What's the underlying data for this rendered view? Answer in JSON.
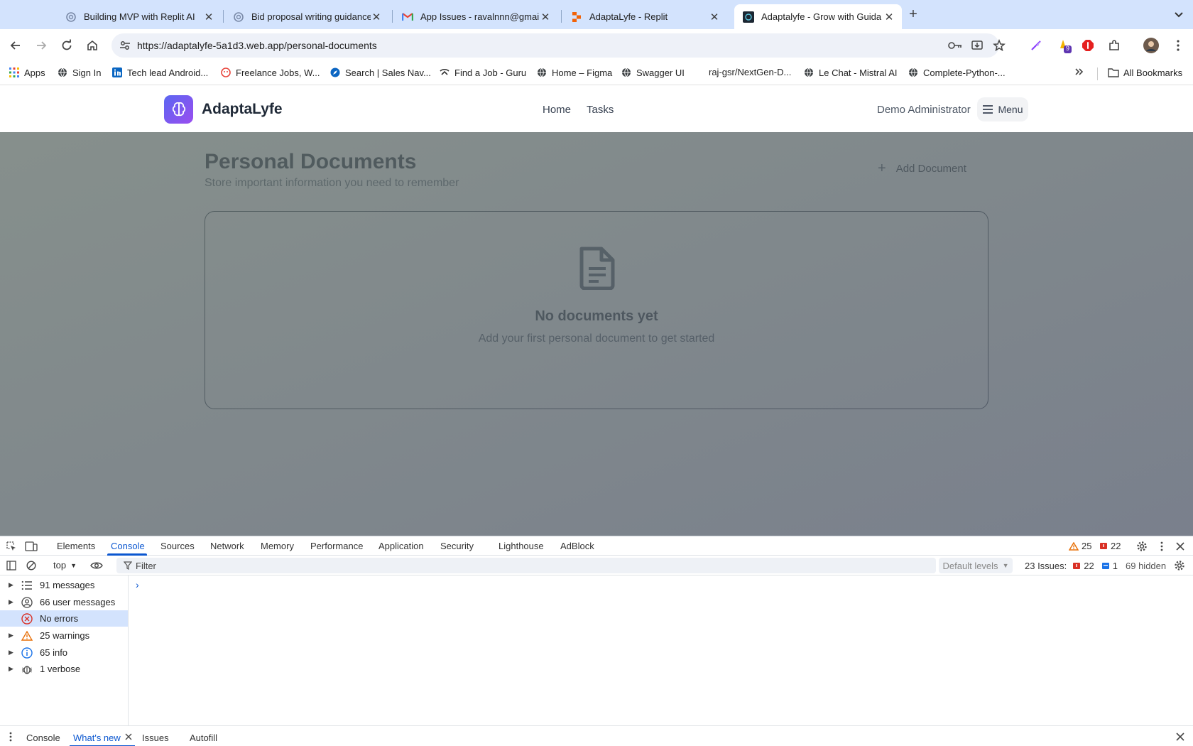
{
  "browser": {
    "tabs": [
      {
        "title": "Building MVP with Replit AI",
        "icon": "chatgpt-icon"
      },
      {
        "title": "Bid proposal writing guidance",
        "icon": "chatgpt-icon"
      },
      {
        "title": "App Issues - ravalnnn@gmail",
        "icon": "gmail-icon"
      },
      {
        "title": "AdaptaLyfe - Replit",
        "icon": "replit-icon"
      },
      {
        "title": "Adaptalyfe - Grow with Guida",
        "icon": "adaptalyfe-icon",
        "active": true
      }
    ],
    "url": "https://adaptalyfe-5a1d3.web.app/personal-documents",
    "extension_badge": "9",
    "bookmarks": [
      {
        "label": "Apps",
        "icon": "apps-grid-icon"
      },
      {
        "label": "Sign In",
        "icon": "globe-icon"
      },
      {
        "label": "Tech lead Android...",
        "icon": "linkedin-icon"
      },
      {
        "label": "Freelance Jobs, W...",
        "icon": "freelancer-icon"
      },
      {
        "label": "Search | Sales Nav...",
        "icon": "compass-icon"
      },
      {
        "label": "Find a Job - Guru",
        "icon": "guru-icon"
      },
      {
        "label": "Home – Figma",
        "icon": "globe-icon"
      },
      {
        "label": "Swagger UI",
        "icon": "globe-icon"
      },
      {
        "label": "raj-gsr/NextGen-D...",
        "icon": "none"
      },
      {
        "label": "Le Chat - Mistral AI",
        "icon": "globe-icon"
      },
      {
        "label": "Complete-Python-...",
        "icon": "globe-icon"
      }
    ],
    "all_bookmarks": "All Bookmarks"
  },
  "app": {
    "brand": "AdaptaLyfe",
    "nav": [
      "Home",
      "Tasks"
    ],
    "user": "Demo Administrator",
    "menu_label": "Menu",
    "page_title": "Personal Documents",
    "page_subtitle": "Store important information you need to remember",
    "add_button": "Add Document",
    "empty_title": "No documents yet",
    "empty_subtitle": "Add your first personal document to get started"
  },
  "devtools": {
    "tabs": [
      "Elements",
      "Console",
      "Sources",
      "Network",
      "Memory",
      "Performance",
      "Application",
      "Security",
      "Lighthouse",
      "AdBlock"
    ],
    "active_tab": "Console",
    "warnings_count": "25",
    "errors_count": "22",
    "context": "top",
    "filter_placeholder": "Filter",
    "levels": "Default levels",
    "issues_label": "23 Issues:",
    "issues_errors": "22",
    "issues_info": "1",
    "hidden": "69 hidden",
    "sidebar": [
      {
        "label": "91 messages",
        "icon": "list-icon"
      },
      {
        "label": "66 user messages",
        "icon": "user-circle-icon"
      },
      {
        "label": "No errors",
        "icon": "error-icon",
        "selected": true
      },
      {
        "label": "25 warnings",
        "icon": "warning-icon"
      },
      {
        "label": "65 info",
        "icon": "info-icon"
      },
      {
        "label": "1 verbose",
        "icon": "bug-icon"
      }
    ],
    "prompt": "›",
    "drawer_tabs": [
      "Console",
      "What's new",
      "Issues",
      "Autofill"
    ]
  },
  "colors": {
    "accent": "#0b57d0",
    "tabstrip": "#d3e3fd",
    "logo_from": "#5b67f1",
    "logo_to": "#9a4df0",
    "warning": "#e8710a",
    "error": "#d93025"
  }
}
